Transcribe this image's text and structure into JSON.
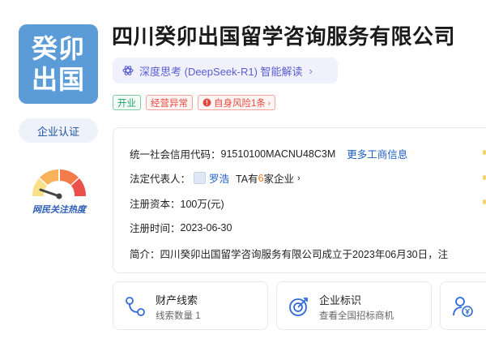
{
  "company": {
    "logo_line1": "癸卯",
    "logo_line2": "出国",
    "name": "四川癸卯出国留学咨询服务有限公司",
    "certification": "企业认证"
  },
  "heat": {
    "label": "网民关注热度",
    "colors": [
      "#fbe08a",
      "#f9b25a",
      "#f47c4a",
      "#e9514a"
    ]
  },
  "ai": {
    "label": "深度思考 (DeepSeek-R1) 智能解读",
    "icon": "atom-icon",
    "accent": "#5a5ecf"
  },
  "tags": {
    "status": "开业",
    "abnormal": "经营异常",
    "risk": "自身风险1条"
  },
  "info": {
    "credit_code_label": "统一社会信用代码：",
    "credit_code": "91510100MACNU48C3M",
    "more_link": "更多工商信息",
    "legal_rep_label": "法定代表人：",
    "legal_rep": "罗浩",
    "ta_has": "TA有",
    "ta_count": "6",
    "ta_suffix": "家企业",
    "capital_label": "注册资本：",
    "capital": "100万(元)",
    "reg_date_label": "注册时间：",
    "reg_date": "2023-06-30",
    "intro_label": "简介：",
    "intro": "四川癸卯出国留学咨询服务有限公司成立于2023年06月30日，注"
  },
  "cards": [
    {
      "title": "财产线索",
      "sub": "线索数量 1",
      "icon": "link-nodes-icon"
    },
    {
      "title": "企业标识",
      "sub": "查看全国招标商机",
      "icon": "target-icon"
    },
    {
      "title": "",
      "sub": "",
      "icon": "person-yen-icon"
    }
  ]
}
